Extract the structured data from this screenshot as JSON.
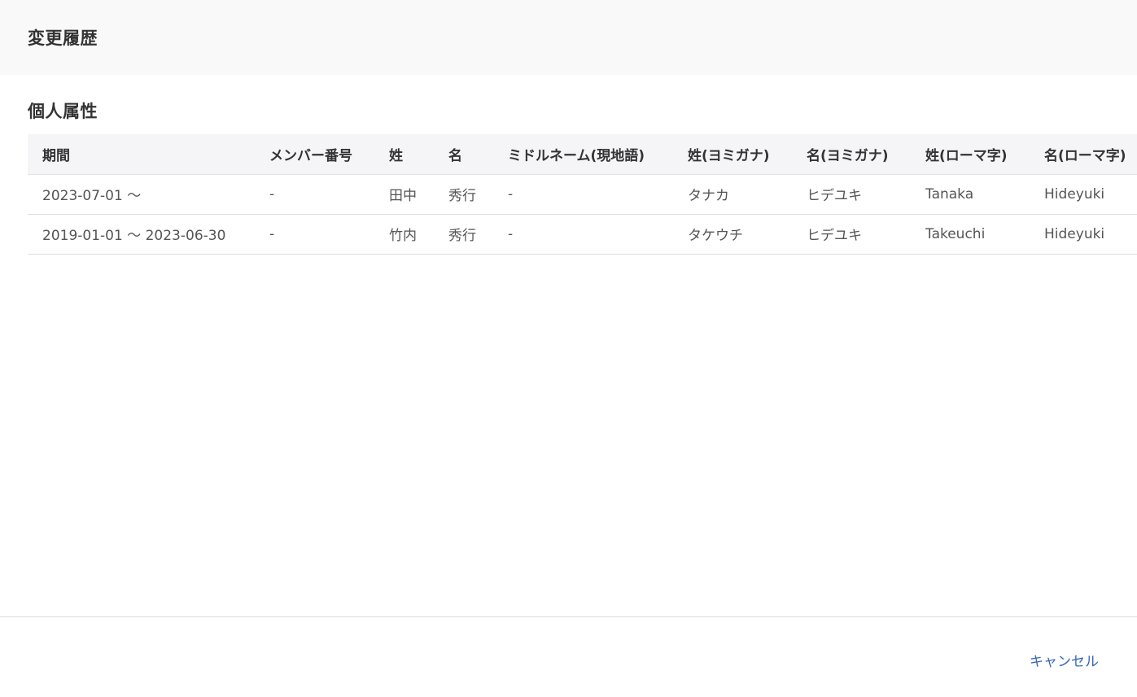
{
  "modal": {
    "title": "変更履歴"
  },
  "section": {
    "title": "個人属性"
  },
  "table": {
    "headers": [
      "期間",
      "メンバー番号",
      "姓",
      "名",
      "ミドルネーム(現地語)",
      "姓(ヨミガナ)",
      "名(ヨミガナ)",
      "姓(ローマ字)",
      "名(ローマ字)"
    ],
    "rows": [
      [
        "2023-07-01 〜",
        "-",
        "田中",
        "秀行",
        "-",
        "タナカ",
        "ヒデユキ",
        "Tanaka",
        "Hideyuki"
      ],
      [
        "2019-01-01 〜 2023-06-30",
        "-",
        "竹内",
        "秀行",
        "-",
        "タケウチ",
        "ヒデユキ",
        "Takeuchi",
        "Hideyuki"
      ]
    ]
  },
  "footer": {
    "cancel_label": "キャンセル"
  },
  "colors": {
    "accent": "#3a66b7",
    "header_bg": "#f9f9fa",
    "table_header_bg": "#f5f5f7"
  }
}
